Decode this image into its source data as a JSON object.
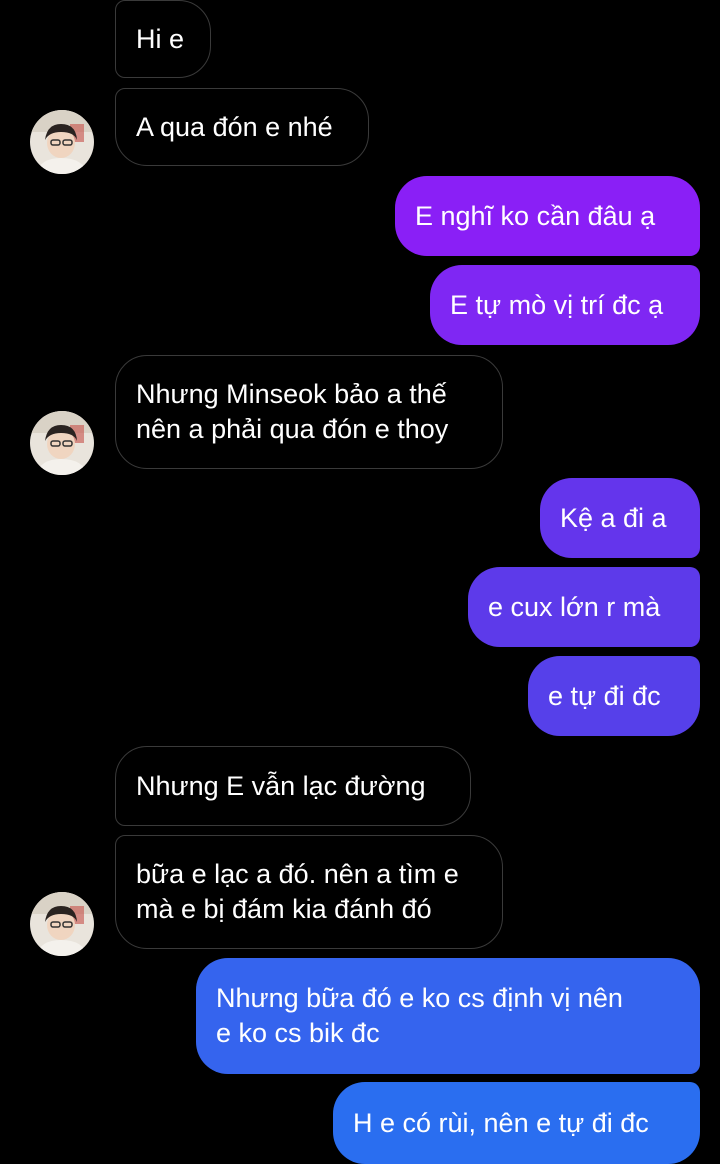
{
  "conversation": {
    "messages": [
      {
        "sender": "them",
        "text": "Hi e"
      },
      {
        "sender": "them",
        "text": "A qua đón e nhé"
      },
      {
        "sender": "me",
        "text": "E nghĩ ko cần đâu ạ"
      },
      {
        "sender": "me",
        "text": "E tự mò vị trí đc ạ"
      },
      {
        "sender": "them",
        "text": "Nhưng Minseok bảo a thế\nnên a phải qua đón e thoy"
      },
      {
        "sender": "me",
        "text": "Kệ a đi a"
      },
      {
        "sender": "me",
        "text": "e cux lớn r mà"
      },
      {
        "sender": "me",
        "text": "e tự đi đc"
      },
      {
        "sender": "them",
        "text": "Nhưng E vẫn lạc đường"
      },
      {
        "sender": "them",
        "text": "bữa e lạc a đó. nên a tìm e\nmà e bị đám kia đánh đó"
      },
      {
        "sender": "me",
        "text": "Nhưng bữa đó e ko cs định vị nên\ne ko cs bik đc"
      },
      {
        "sender": "me",
        "text": "H e có rùi, nên e tự đi đc"
      }
    ]
  },
  "colors": {
    "background": "#000000",
    "incoming_border": "#3a3a3a",
    "outgoing_gradient_top": "#8a1ff6",
    "outgoing_gradient_mid": "#5a3ae8",
    "outgoing_gradient_bottom": "#2a6ef0"
  },
  "icons": {
    "avatar": "contact-avatar-photo"
  }
}
